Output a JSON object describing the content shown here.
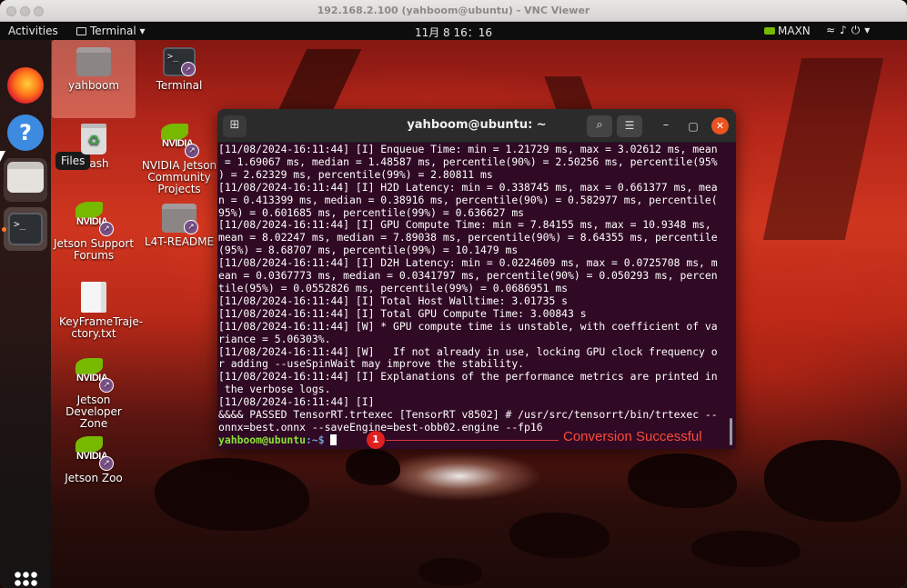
{
  "vnc": {
    "title": "192.168.2.100 (yahboom@ubuntu) - VNC Viewer"
  },
  "topbar": {
    "activities": "Activities",
    "app_menu": "Terminal ▾",
    "clock": "11月 8 16：16",
    "maxn": "MAXN",
    "tray": "≈♪⏻▾"
  },
  "dock": {
    "files_tooltip": "Files"
  },
  "desktop_icons": {
    "yahboom": "yahboom",
    "terminal": "Terminal",
    "trash": "ash",
    "nvidia_projects": "NVIDIA Jetson Community Projects",
    "support_forums": "Jetson Support Forums",
    "readme": "L4T-README",
    "keyframe": "KeyFrameTraje-ctory.txt",
    "dev_zone": "Jetson Developer Zone",
    "zoo": "Jetson Zoo"
  },
  "terminal": {
    "title": "yahboom@ubuntu: ~",
    "lines": [
      "[11/08/2024-16:11:44] [I] Enqueue Time: min = 1.21729 ms, max = 3.02612 ms, mean",
      " = 1.69067 ms, median = 1.48587 ms, percentile(90%) = 2.50256 ms, percentile(95%",
      ") = 2.62329 ms, percentile(99%) = 2.80811 ms",
      "[11/08/2024-16:11:44] [I] H2D Latency: min = 0.338745 ms, max = 0.661377 ms, mea",
      "n = 0.413399 ms, median = 0.38916 ms, percentile(90%) = 0.582977 ms, percentile(",
      "95%) = 0.601685 ms, percentile(99%) = 0.636627 ms",
      "[11/08/2024-16:11:44] [I] GPU Compute Time: min = 7.84155 ms, max = 10.9348 ms,",
      "mean = 8.02247 ms, median = 7.89038 ms, percentile(90%) = 8.64355 ms, percentile",
      "(95%) = 8.68707 ms, percentile(99%) = 10.1479 ms",
      "[11/08/2024-16:11:44] [I] D2H Latency: min = 0.0224609 ms, max = 0.0725708 ms, m",
      "ean = 0.0367773 ms, median = 0.0341797 ms, percentile(90%) = 0.050293 ms, percen",
      "tile(95%) = 0.0552826 ms, percentile(99%) = 0.0686951 ms",
      "[11/08/2024-16:11:44] [I] Total Host Walltime: 3.01735 s",
      "[11/08/2024-16:11:44] [I] Total GPU Compute Time: 3.00843 s",
      "[11/08/2024-16:11:44] [W] * GPU compute time is unstable, with coefficient of va",
      "riance = 5.06303%.",
      "[11/08/2024-16:11:44] [W]   If not already in use, locking GPU clock frequency o",
      "r adding --useSpinWait may improve the stability.",
      "[11/08/2024-16:11:44] [I] Explanations of the performance metrics are printed in",
      " the verbose logs.",
      "[11/08/2024-16:11:44] [I]",
      "&&&& PASSED TensorRT.trtexec [TensorRT v8502] # /usr/src/tensorrt/bin/trtexec --",
      "onnx=best.onnx --saveEngine=best-obb02.engine --fp16"
    ],
    "prompt_user": "yahboom@ubuntu",
    "prompt_path": ":~$ "
  },
  "annotation": {
    "number": "1",
    "text": "Conversion Successful"
  }
}
